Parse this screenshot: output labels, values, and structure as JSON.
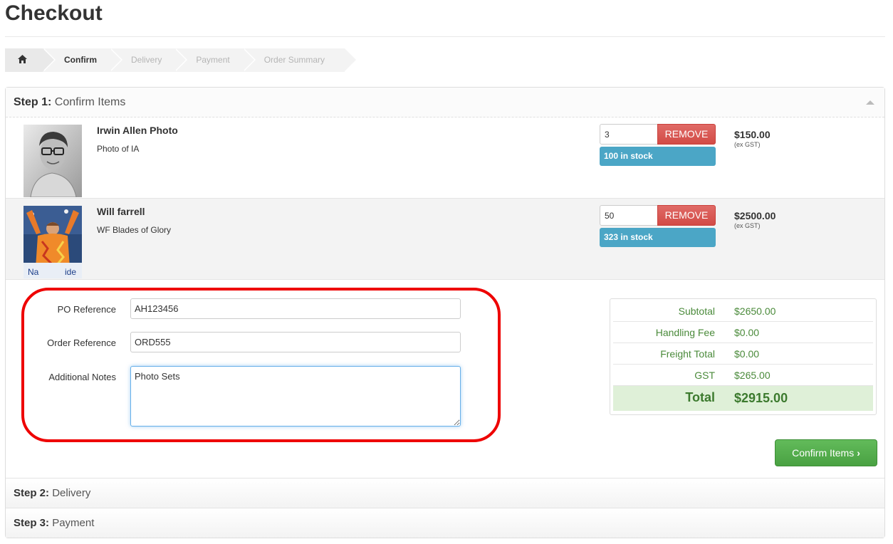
{
  "page": {
    "title": "Checkout"
  },
  "breadcrumb": {
    "home_icon": "home-icon",
    "steps": [
      "Confirm",
      "Delivery",
      "Payment",
      "Order Summary"
    ]
  },
  "step1": {
    "prefix": "Step 1:",
    "title": "Confirm Items"
  },
  "items": [
    {
      "name": "Irwin Allen Photo",
      "description": "Photo of IA",
      "qty": "3",
      "remove_label": "REMOVE",
      "stock": "100 in stock",
      "price": "$150.00",
      "tax_note": "(ex GST)"
    },
    {
      "name": "Will farrell",
      "description": "WF Blades of Glory",
      "qty": "50",
      "remove_label": "REMOVE",
      "stock": "323 in stock",
      "price": "$2500.00",
      "tax_note": "(ex GST)"
    }
  ],
  "form": {
    "po_label": "PO Reference",
    "po_value": "AH123456",
    "order_label": "Order Reference",
    "order_value": "ORD555",
    "notes_label": "Additional Notes",
    "notes_value": "Photo Sets"
  },
  "totals": {
    "subtotal_label": "Subtotal",
    "subtotal": "$2650.00",
    "handling_label": "Handling Fee",
    "handling": "$0.00",
    "freight_label": "Freight Total",
    "freight": "$0.00",
    "gst_label": "GST",
    "gst": "$265.00",
    "total_label": "Total",
    "total": "$2915.00"
  },
  "confirm_button": {
    "label": "Confirm Items",
    "icon": "chevron-right-icon"
  },
  "step2": {
    "prefix": "Step 2:",
    "title": "Delivery"
  },
  "step3": {
    "prefix": "Step 3:",
    "title": "Payment"
  },
  "colors": {
    "remove": "#d9534f",
    "stock": "#4ba6c6",
    "confirm": "#5cb85c",
    "total_bg": "#dff0d8",
    "highlight": "#ee0000"
  }
}
